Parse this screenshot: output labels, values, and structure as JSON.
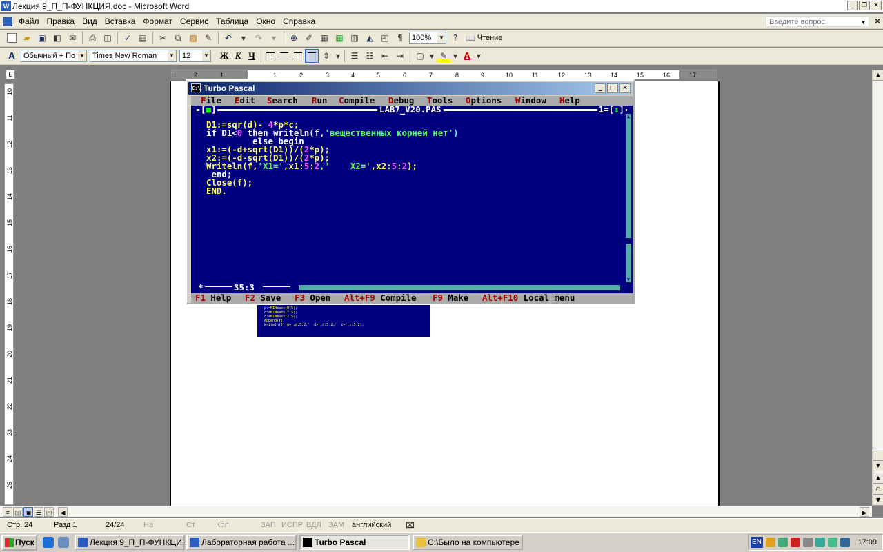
{
  "word": {
    "title": "Лекция 9_П_П-ФУНКЦИЯ.doc - Microsoft Word",
    "menu": [
      "Файл",
      "Правка",
      "Вид",
      "Вставка",
      "Формат",
      "Сервис",
      "Таблица",
      "Окно",
      "Справка"
    ],
    "ask_placeholder": "Введите вопрос",
    "zoom": "100%",
    "reading_label": "Чтение",
    "style_value": "Обычный + По ц",
    "font_value": "Times New Roman",
    "size_value": "12",
    "ruler_h": [
      "3",
      "2",
      "1",
      "1",
      "2",
      "3",
      "4",
      "5",
      "6",
      "7",
      "8",
      "9",
      "10",
      "11",
      "12",
      "13",
      "14",
      "15",
      "16",
      "17"
    ],
    "ruler_v": [
      "10",
      "11",
      "12",
      "13",
      "14",
      "15",
      "16",
      "17",
      "18",
      "19",
      "20",
      "21",
      "22",
      "23",
      "24",
      "25"
    ]
  },
  "statusbar": {
    "page": "Стр. 24",
    "section": "Разд 1",
    "pages": "24/24",
    "at": "На",
    "line": "Ст",
    "col": "Кол",
    "rec": "ЗАП",
    "trk": "ИСПР",
    "ext": "ВДЛ",
    "ovr": "ЗАМ",
    "lang": "английский"
  },
  "taskbar": {
    "start": "Пуск",
    "tasks": [
      {
        "label": "Лекция 9_П_П-ФУНКЦИ...",
        "active": false
      },
      {
        "label": "Лабораторная работа ...",
        "active": false
      },
      {
        "label": "Turbo Pascal",
        "active": true
      },
      {
        "label": "C:\\Было на компьютере",
        "active": false
      }
    ],
    "lang": "EN",
    "clock": "17:09"
  },
  "turbo_pascal": {
    "title": "Turbo Pascal",
    "menu": [
      {
        "hot": "F",
        "rest": "ile"
      },
      {
        "hot": "E",
        "rest": "dit"
      },
      {
        "hot": "S",
        "rest": "earch"
      },
      {
        "hot": "R",
        "rest": "un"
      },
      {
        "hot": "C",
        "rest": "ompile"
      },
      {
        "hot": "D",
        "rest": "ebug"
      },
      {
        "hot": "T",
        "rest": "ools"
      },
      {
        "hot": "O",
        "rest": "ptions"
      },
      {
        "hot": "W",
        "rest": "indow"
      },
      {
        "hot": "H",
        "rest": "elp"
      }
    ],
    "filename": "LAB7_V20.PAS",
    "window_number": "1",
    "cursor_pos": "35:3",
    "code": [
      [
        [
          "D1:=sqr(d)- ",
          "i"
        ],
        [
          "4",
          "n"
        ],
        [
          "*p*c;",
          "i"
        ]
      ],
      [
        [
          "if D1<",
          "k"
        ],
        [
          "0",
          "n"
        ],
        [
          " then writeln(f,",
          "k"
        ],
        [
          "'вещественных корней нет'",
          "s"
        ],
        [
          ")",
          "p"
        ]
      ],
      [
        [
          "         else begin",
          "k"
        ]
      ],
      [
        [
          "x1:=(-d+sqrt(D1))/(",
          "i"
        ],
        [
          "2",
          "n"
        ],
        [
          "*p);",
          "i"
        ]
      ],
      [
        [
          "x2:=(-d-sqrt(D1))/(",
          "i"
        ],
        [
          "2",
          "n"
        ],
        [
          "*p);",
          "i"
        ]
      ],
      [
        [
          "Writeln(f,",
          "i"
        ],
        [
          "'X1='",
          "s"
        ],
        [
          ",x1:",
          "i"
        ],
        [
          "5",
          "n"
        ],
        [
          ":",
          "i"
        ],
        [
          "2",
          "n"
        ],
        [
          ",'    X2='",
          "s"
        ],
        [
          ",x2:",
          "i"
        ],
        [
          "5",
          "n"
        ],
        [
          ":",
          "i"
        ],
        [
          "2",
          "n"
        ],
        [
          ");",
          "i"
        ]
      ],
      [
        [
          " end;",
          "k"
        ]
      ],
      [
        [
          "Close(f);",
          "i"
        ]
      ],
      [
        [
          "END.",
          "i"
        ]
      ]
    ],
    "status": [
      {
        "key": "F1",
        "label": "Help"
      },
      {
        "key": "F2",
        "label": "Save"
      },
      {
        "key": "F3",
        "label": "Open"
      },
      {
        "key": "Alt+F9",
        "label": "Compile"
      },
      {
        "key": "F9",
        "label": "Make"
      },
      {
        "key": "Alt+F10",
        "label": "Local menu"
      }
    ]
  },
  "fragment_lines": [
    "p:=MINmass(U,5);",
    "d:=MINmass(Y,5);",
    "c:=MINmass(Z,5);",
    "Append(f);",
    "Writeln(f,'p=',p:5:2,'  d=',d:5:2,'  c=',c:5:2);"
  ]
}
